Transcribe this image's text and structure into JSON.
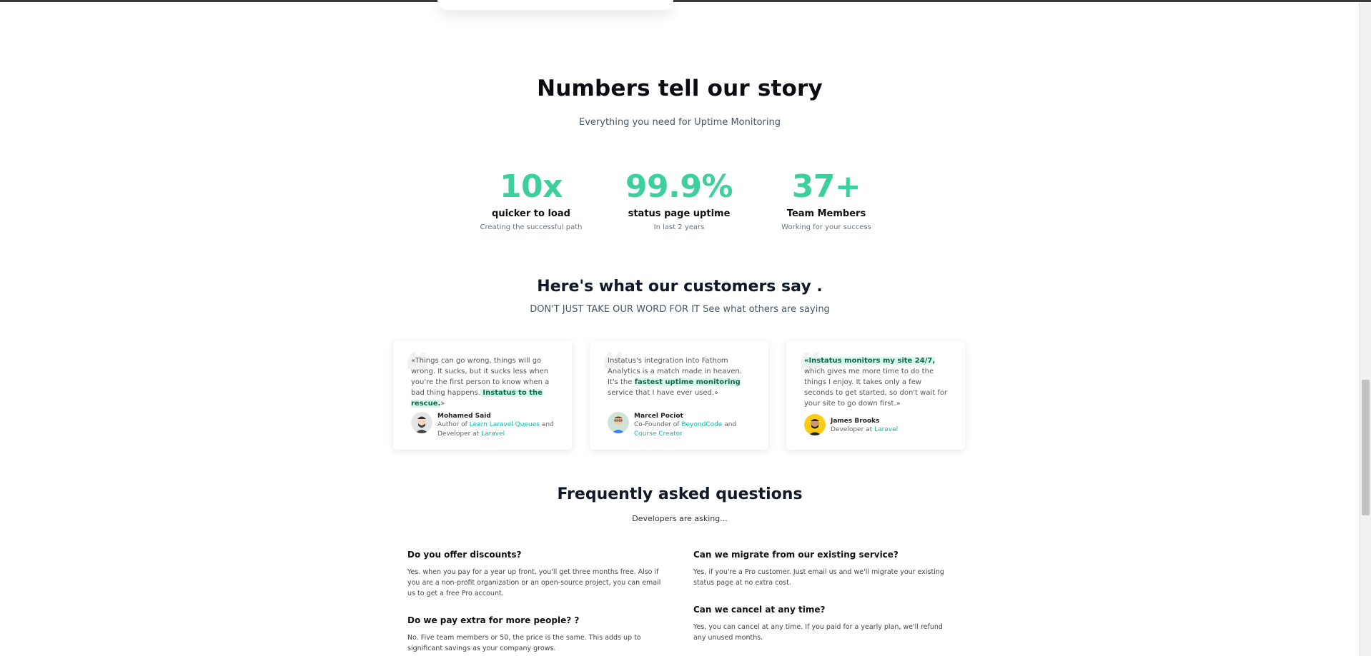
{
  "stats_section": {
    "title": "Numbers tell our story",
    "subtitle": "Everything you need for Uptime Monitoring",
    "stats": [
      {
        "value": "10x",
        "label": "quicker to load",
        "desc": "Creating the successful path"
      },
      {
        "value": "99.9%",
        "label": "status page uptime",
        "desc": "In last 2 years"
      },
      {
        "value": "37+",
        "label": "Team Members",
        "desc": "Working for your success"
      }
    ]
  },
  "testimonials": {
    "title": "Here's what our customers say .",
    "subtitle": "DON'T JUST TAKE OUR WORD FOR IT See what others are saying",
    "items": [
      {
        "quote_a": "«Things can go wrong, things will go wrong. It sucks, but it sucks less when you're the first person to know when a bad thing happens.",
        "quote_hl": " Instatus to the rescue.",
        "quote_b": "»",
        "name": "Mohamed Said",
        "role_a": "Author of ",
        "link1": "Learn Laravel Queues",
        "role_b": " and Developer at ",
        "link2": "Laravel"
      },
      {
        "quote_a": "Instatus's integration into Fathom Analytics is a match made in heaven. It's the ",
        "quote_hl": "fastest uptime monitoring",
        "quote_b": " service that I have ever used.»",
        "name": "Marcel Pociot",
        "role_a": "Co-Founder of ",
        "link1": "BeyondCode",
        "role_b": " and ",
        "link2": "Course Creator"
      },
      {
        "quote_hl": "«Instatus monitors my site 24/7,",
        "quote_b": " which gives me more time to do the things I enjoy. It takes only a few seconds to get started, so don't wait for your site to go down first.»",
        "name": "James Brooks",
        "role_a": "Developer at ",
        "link1": "Laravel"
      }
    ]
  },
  "faq": {
    "title": "Frequently asked questions",
    "subtitle": "Developers are asking...",
    "items": [
      {
        "q": "Do you offer discounts?",
        "a": "Yes. when you pay for a year up front, you'll get three months free. Also if you are a non-profit organization or an open-source project, you can email us to get a free Pro account."
      },
      {
        "q": "Do we pay extra for more people? ?",
        "a": "No. Five team members or 50, the price is the same. This adds up to significant savings as your company grows."
      },
      {
        "q": "Can we migrate from our existing service?",
        "a": "Yes, if you're a Pro customer. Just email us and we'll migrate your existing status page at no extra cost."
      },
      {
        "q": "Can we cancel at any time?",
        "a": "Yes, you can cancel at any time. If you paid for a yearly plan, we'll refund any unused months."
      }
    ]
  }
}
